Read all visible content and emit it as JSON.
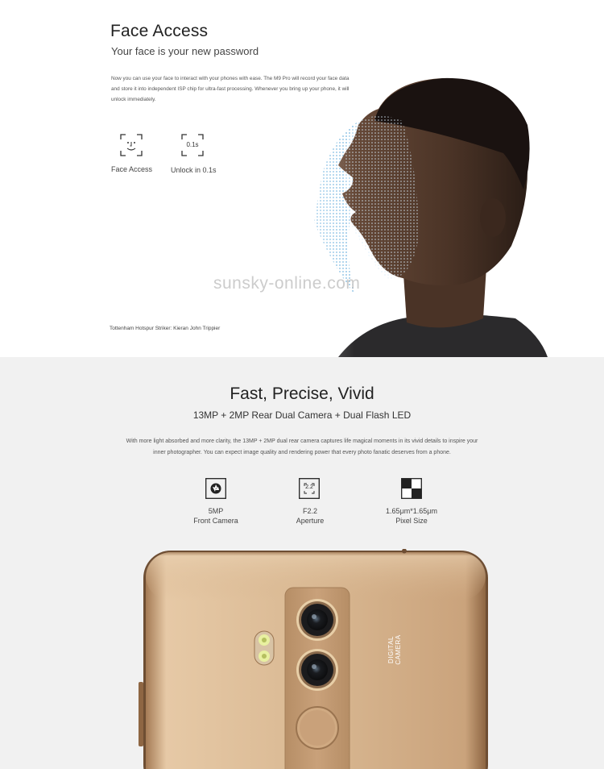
{
  "face_section": {
    "title": "Face Access",
    "subtitle": "Your face is your new password",
    "description": "Now you can use your face to interact with your phones with ease. The M9 Pro will record your face data and store it into independent ISP chip for ultra-fast processing. Whenever you bring up your phone, it will unlock immediately.",
    "features": [
      {
        "icon": "face-scan-icon",
        "label": "Face Access"
      },
      {
        "icon": "timer-icon",
        "icon_text": "0.1s",
        "label": "Unlock in 0.1s"
      }
    ],
    "caption": "Tottenham Hotspur Striker: Kieran John Trippier",
    "watermark": "sunsky-online.com"
  },
  "camera_section": {
    "title": "Fast, Precise, Vivid",
    "subtitle": "13MP + 2MP Rear Dual Camera + Dual Flash LED",
    "description": "With more light absorbed and more clarity, the 13MP + 2MP dual rear camera captures life magical moments in its vivid details to inspire your inner photographer. You can expect image quality and rendering power that every photo fanatic deserves from a phone.",
    "features": [
      {
        "icon": "aperture-icon",
        "line1": "5MP",
        "line2": "Front Camera"
      },
      {
        "icon": "f-stop-icon",
        "icon_text": "2.2",
        "line1": "F2.2",
        "line2": "Aperture"
      },
      {
        "icon": "pixel-grid-icon",
        "line1": "1.65μm*1.65μm",
        "line2": "Pixel Size"
      }
    ],
    "phone_label": "DIGITAL\nCAMERA"
  },
  "colors": {
    "top_bg": "#ffffff",
    "bottom_bg": "#f1f1f1",
    "phone_gold": "#c9a27a",
    "dots": "#4a9fd6"
  }
}
